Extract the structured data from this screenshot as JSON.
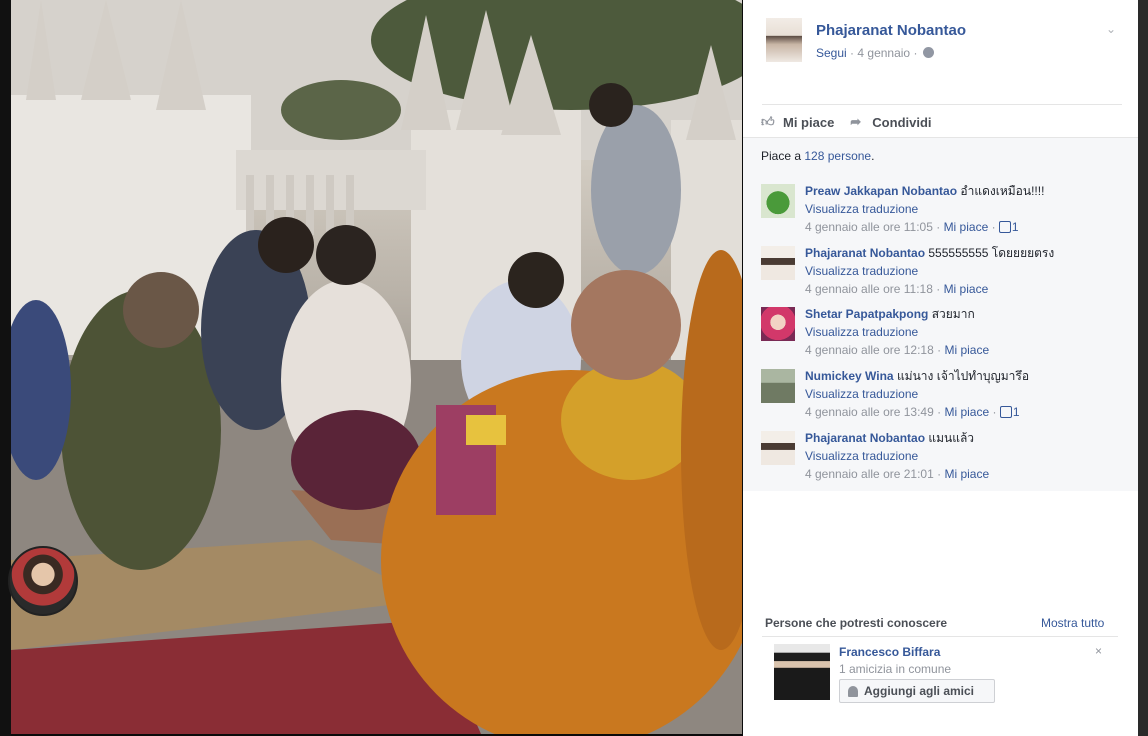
{
  "post": {
    "author": "Phajaranat Nobantao",
    "follow_label": "Segui",
    "date": "4 gennaio",
    "meta_separator": "·",
    "privacy_icon": "globe-icon",
    "menu_icon": "chevron-down-icon"
  },
  "actions": {
    "like_label": "Mi piace",
    "share_label": "Condividi"
  },
  "likes": {
    "prefix": "Piace a",
    "link": "128 persone",
    "suffix": "."
  },
  "comments": [
    {
      "name": "Preaw Jakkapan Nobantao",
      "text": "อำแดงเหมือน!!!!",
      "translate": "Visualizza traduzione",
      "time": "4 gennaio alle ore 11:05",
      "like_label": "Mi piace",
      "like_count": "1"
    },
    {
      "name": "Phajaranat Nobantao",
      "text": "555555555 โดยยยยตรง",
      "translate": "Visualizza traduzione",
      "time": "4 gennaio alle ore 11:18",
      "like_label": "Mi piace",
      "like_count": ""
    },
    {
      "name": "Shetar Papatpakpong",
      "text": "สวยมาก",
      "translate": "Visualizza traduzione",
      "time": "4 gennaio alle ore 12:18",
      "like_label": "Mi piace",
      "like_count": ""
    },
    {
      "name": "Numickey Wina",
      "text": "แม่นาง เจ้าไปทำบุญมารึอ",
      "translate": "Visualizza traduzione",
      "time": "4 gennaio alle ore 13:49",
      "like_label": "Mi piace",
      "like_count": "1"
    },
    {
      "name": "Phajaranat Nobantao",
      "text": "แมนแล้ว",
      "translate": "Visualizza traduzione",
      "time": "4 gennaio alle ore 21:01",
      "like_label": "Mi piace",
      "like_count": ""
    }
  ],
  "pymk": {
    "title": "Persone che potresti conoscere",
    "show_all": "Mostra tutto",
    "person_name": "Francesco Biffara",
    "mutual": "1 amicizia in comune",
    "add_button": "Aggiungi agli amici",
    "close": "×"
  },
  "colors": {
    "link": "#365899",
    "meta": "#90949c",
    "panel_bg": "#ffffff",
    "comments_bg": "#f6f7f9"
  }
}
